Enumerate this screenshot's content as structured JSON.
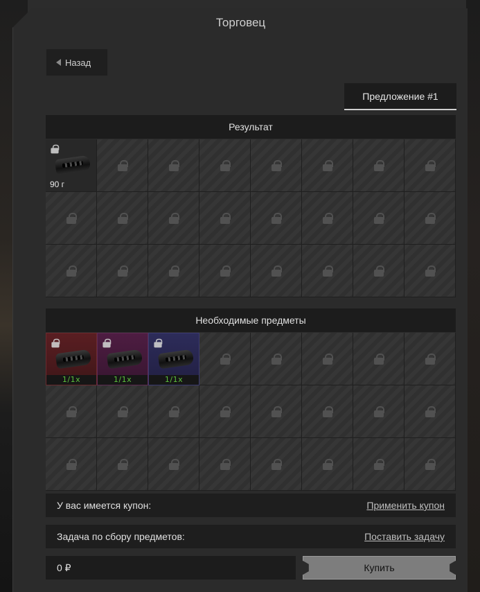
{
  "window": {
    "title": "Торговец"
  },
  "nav": {
    "back_label": "Назад"
  },
  "tabs": [
    {
      "label": "Предложение #1",
      "active": true
    }
  ],
  "result": {
    "header": "Результат",
    "items": [
      {
        "weight": "90 г",
        "icon": "muzzle-brake-icon"
      }
    ]
  },
  "required": {
    "header": "Необходимые предметы",
    "items": [
      {
        "count": "1/1x",
        "color": "#5a1e22",
        "icon": "muzzle-brake-icon"
      },
      {
        "count": "1/1x",
        "color": "#4e1d42",
        "icon": "muzzle-brake-icon"
      },
      {
        "count": "1/1x",
        "color": "#2d2c5a",
        "icon": "muzzle-brake-icon"
      }
    ]
  },
  "coupon": {
    "label": "У вас имеется купон:",
    "action": "Применить купон"
  },
  "task": {
    "label": "Задача по сбору предметов:",
    "action": "Поставить задачу"
  },
  "purchase": {
    "price": "0 ₽",
    "buy_label": "Купить"
  },
  "colors": {
    "count_green": "#5cbf3c",
    "buy_button": "#7d7d7d"
  }
}
